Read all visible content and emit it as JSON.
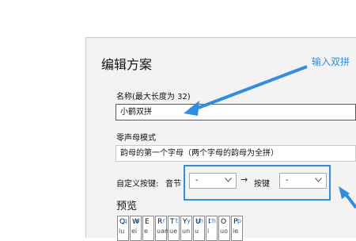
{
  "dialog": {
    "title": "编辑方案",
    "name_label": "名称(最大长度为 32)",
    "name_value": "小鹤双拼",
    "zero_label": "零声母模式",
    "zero_value": "韵母的第一个字母（两个字母的韵母为全拼）",
    "custom_label": "自定义按键:",
    "syllable_label": "音节",
    "from_value": "-",
    "arrow_symbol": "→",
    "key_label": "按键",
    "to_value": "-",
    "preview_label": "预览"
  },
  "annotation": {
    "callout_text": "输入双拼",
    "color": "#2f8de4"
  },
  "keys": [
    {
      "k": "Q",
      "s": "q",
      "y": "iu",
      "f": ""
    },
    {
      "k": "W",
      "s": "w",
      "y": "ei",
      "f": ""
    },
    {
      "k": "E",
      "s": "",
      "y": "e",
      "f": ""
    },
    {
      "k": "R",
      "s": "r",
      "y": "uan",
      "f": ""
    },
    {
      "k": "T",
      "s": "t",
      "y": "ue",
      "f": ""
    },
    {
      "k": "Y",
      "s": "y",
      "y": "un",
      "f": ""
    },
    {
      "k": "U",
      "s": "sh",
      "y": "u",
      "f": ""
    },
    {
      "k": "I",
      "s": "ch",
      "y": "i",
      "f": ""
    },
    {
      "k": "O",
      "s": "",
      "y": "uo",
      "f": ""
    },
    {
      "k": "P",
      "s": "p",
      "y": "ie",
      "f": ""
    }
  ]
}
